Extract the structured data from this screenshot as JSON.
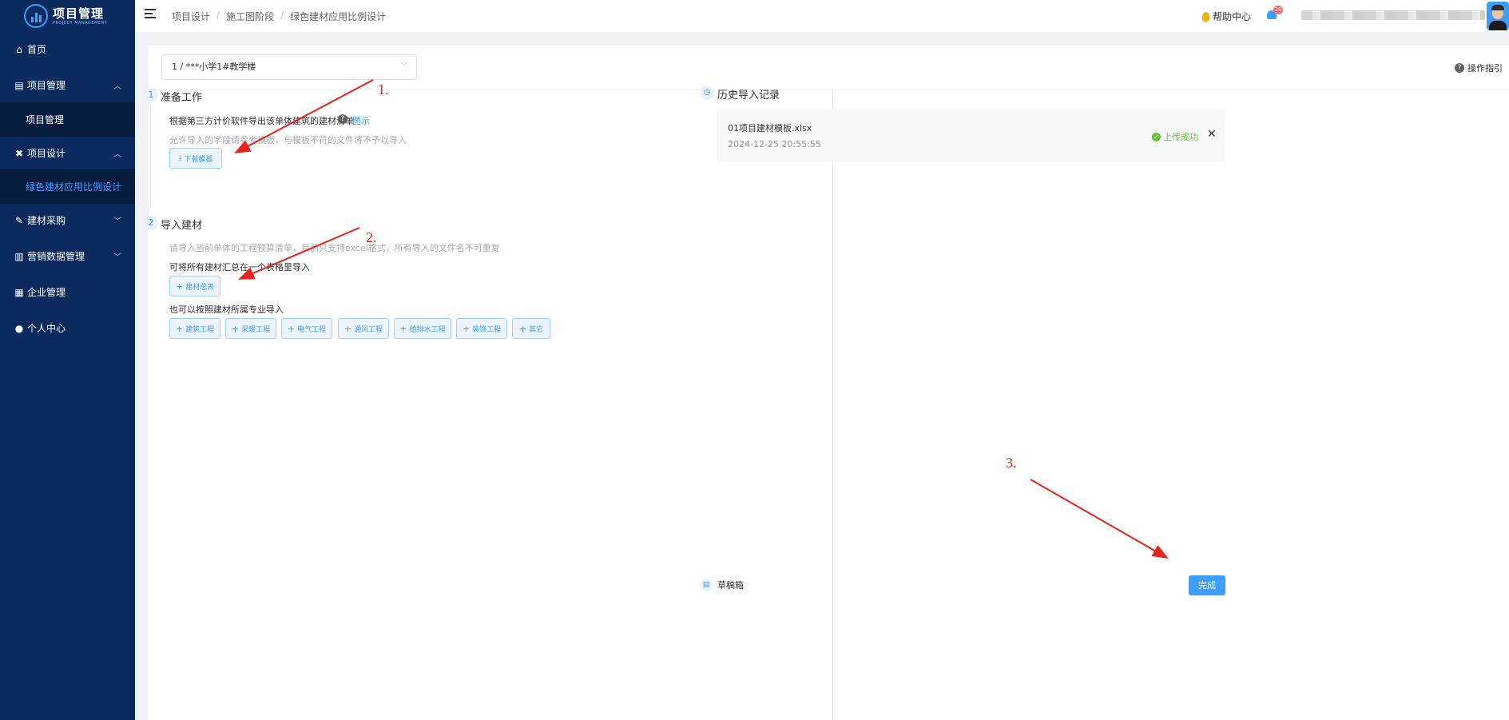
{
  "app": {
    "title": "项目管理",
    "subtitle": "PROJECT MANAGEMENT"
  },
  "sidebar": {
    "items": [
      {
        "label": "首页",
        "icon": "home-icon"
      },
      {
        "label": "项目管理",
        "icon": "project-icon"
      },
      {
        "label": "项目管理",
        "icon": ""
      },
      {
        "label": "项目设计",
        "icon": "design-icon"
      },
      {
        "label": "绿色建材应用比例设计",
        "icon": ""
      },
      {
        "label": "建材采购",
        "icon": "purchase-icon"
      },
      {
        "label": "营销数据管理",
        "icon": "chart-icon"
      },
      {
        "label": "企业管理",
        "icon": "company-icon"
      },
      {
        "label": "个人中心",
        "icon": "user-icon"
      }
    ]
  },
  "header": {
    "breadcrumb": [
      "项目设计",
      "施工图阶段",
      "绿色建材应用比例设计"
    ],
    "help": "帮助中心",
    "notif_count": "28"
  },
  "toolbar": {
    "building_select": "1 / ***小学1#教学楼",
    "guide": "操作指引"
  },
  "step1": {
    "num": "1",
    "title": "准备工作",
    "desc": "根据第三方计价软件导出该单体建筑的建材清单",
    "diagram_link": "图示",
    "hint": "允许导入的字段请参考模板，与模板不符的文件将不予以导入",
    "download_btn": "下载模板"
  },
  "step2": {
    "num": "2",
    "title": "导入建材",
    "hint": "请导入当前单体的工程预算清单，目前只支持excel格式，所有导入的文件名不可重复",
    "summary_label": "可将所有建材汇总在一个表格里导入",
    "summary_btn": "建材总表",
    "specialty_label": "也可以按照建材所属专业导入",
    "specialty_btns": [
      "建筑工程",
      "采暖工程",
      "电气工程",
      "通风工程",
      "给排水工程",
      "装饰工程",
      "其它"
    ]
  },
  "history": {
    "title": "历史导入记录",
    "records": [
      {
        "file": "01项目建材模板.xlsx",
        "time": "2024-12-25 20:55:55",
        "status": "上传成功"
      }
    ]
  },
  "footer": {
    "draft": "草稿箱",
    "done": "完成"
  },
  "annotations": [
    "1.",
    "2.",
    "3."
  ],
  "colors": {
    "sidebar_bg": "#0b2a5e",
    "primary": "#409eff",
    "success": "#67c23a",
    "annotation": "#e8231a"
  }
}
